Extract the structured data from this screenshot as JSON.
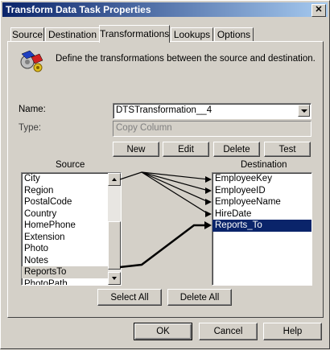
{
  "window": {
    "title": "Transform Data Task Properties",
    "close_glyph": "✕"
  },
  "tabs": [
    {
      "label": "Source"
    },
    {
      "label": "Destination"
    },
    {
      "label": "Transformations",
      "active": true
    },
    {
      "label": "Lookups"
    },
    {
      "label": "Options"
    }
  ],
  "header": {
    "icon": "transform-icon",
    "description": "Define the transformations between the source and destination."
  },
  "form": {
    "name_label": "Name:",
    "name_value": "DTSTransformation__4",
    "type_label": "Type:",
    "type_value": "Copy Column"
  },
  "actions": {
    "new": "New",
    "edit": "Edit",
    "delete": "Delete",
    "test": "Test"
  },
  "source": {
    "header": "Source",
    "items": [
      "City",
      "Region",
      "PostalCode",
      "Country",
      "HomePhone",
      "Extension",
      "Photo",
      "Notes",
      "ReportsTo",
      "PhotoPath"
    ],
    "highlighted": "ReportsTo"
  },
  "destination": {
    "header": "Destination",
    "items": [
      "EmployeeKey",
      "EmployeeID",
      "EmployeeName",
      "HireDate",
      "Reports_To"
    ],
    "selected": "Reports_To"
  },
  "bulk": {
    "select_all": "Select All",
    "delete_all": "Delete All"
  },
  "footer": {
    "ok": "OK",
    "cancel": "Cancel",
    "help": "Help"
  },
  "colors": {
    "title_start": "#0a246a",
    "title_end": "#a6caf0",
    "selection": "#0a246a",
    "face": "#d4d0c8"
  }
}
